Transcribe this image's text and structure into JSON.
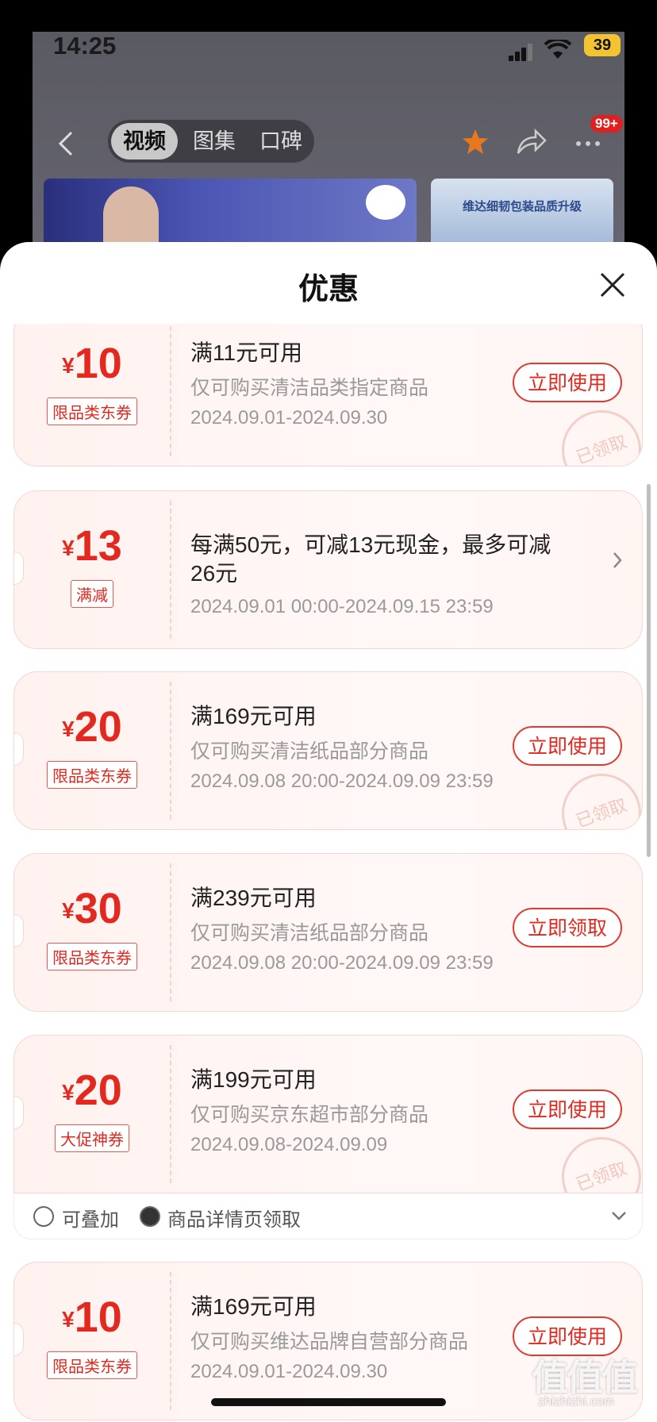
{
  "status": {
    "time": "14:25",
    "battery": "39"
  },
  "nav": {
    "tabs": [
      "视频",
      "图集",
      "口碑"
    ],
    "badge": "99+"
  },
  "banner": {
    "right_text": "维达细韧包装品质升级"
  },
  "sheet": {
    "title": "优惠"
  },
  "coupons": [
    {
      "currency": "¥",
      "amount": "10",
      "tag": "限品类东券",
      "line1": "满11元可用",
      "line2": "仅可购买清洁品类指定商品",
      "line3": "2024.09.01-2024.09.30",
      "button": "立即使用",
      "stamp": "已领取"
    },
    {
      "currency": "¥",
      "amount": "13",
      "tag": "满减",
      "line1": "每满50元，可减13元现金，最多可减",
      "line1b": "26元",
      "line3": "2024.09.01 00:00-2024.09.15 23:59"
    },
    {
      "currency": "¥",
      "amount": "20",
      "tag": "限品类东券",
      "line1": "满169元可用",
      "line2": "仅可购买清洁纸品部分商品",
      "line3": "2024.09.08 20:00-2024.09.09 23:59",
      "button": "立即使用",
      "stamp": "已领取"
    },
    {
      "currency": "¥",
      "amount": "30",
      "tag": "限品类东券",
      "line1": "满239元可用",
      "line2": "仅可购买清洁纸品部分商品",
      "line3": "2024.09.08 20:00-2024.09.09 23:59",
      "button": "立即领取"
    },
    {
      "currency": "¥",
      "amount": "20",
      "tag": "大促神券",
      "line1": "满199元可用",
      "line2": "仅可购买京东超市部分商品",
      "line3": "2024.09.08-2024.09.09",
      "button": "立即使用",
      "stamp": "已领取"
    },
    {
      "currency": "¥",
      "amount": "10",
      "tag": "限品类东券",
      "line1": "满169元可用",
      "line2": "仅可购买维达品牌自营部分商品",
      "line3": "2024.09.01-2024.09.30",
      "button": "立即使用"
    }
  ],
  "extra": {
    "stackable": "可叠加",
    "source": "商品详情页领取"
  },
  "watermark": {
    "logo": "值值值",
    "site": "zhizhizhi.com"
  }
}
